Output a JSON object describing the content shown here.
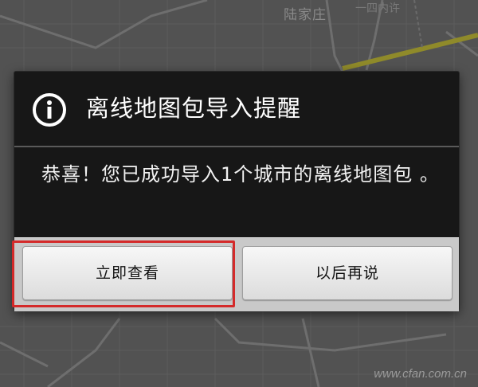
{
  "map": {
    "place_label": "陆家庄",
    "place_label_2": "一四内许"
  },
  "dialog": {
    "title": "离线地图包导入提醒",
    "message": "恭喜！您已成功导入1个城市的离线地图包 。",
    "icon": "info-icon",
    "buttons": {
      "view_now": "立即查看",
      "later": "以后再说"
    }
  },
  "watermark": "www.cfan.com.cn",
  "colors": {
    "dialog_bg": "#171717",
    "button_bar_bg": "#c9c9c9",
    "highlight": "#d42a2a",
    "map_road_yellow": "#8f8a2a"
  }
}
